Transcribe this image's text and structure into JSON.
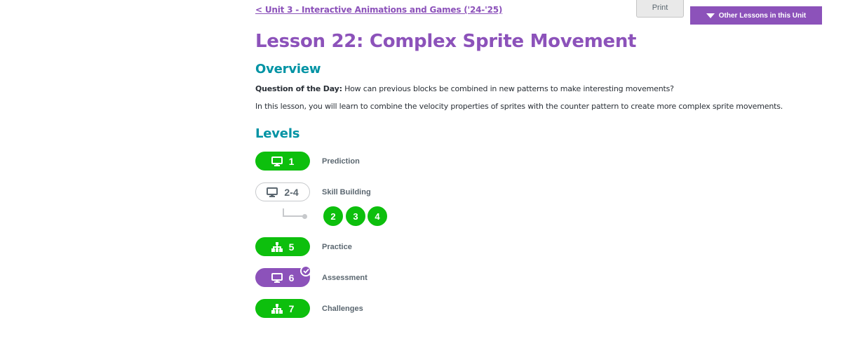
{
  "header": {
    "back_link": "< Unit 3 - Interactive Animations and Games ('24-'25)",
    "print_label": "Print",
    "other_lessons_label": "Other Lessons in this Unit"
  },
  "lesson": {
    "title": "Lesson 22: Complex Sprite Movement"
  },
  "overview": {
    "heading": "Overview",
    "qotd_label": "Question of the Day:",
    "qotd_text": " How can previous blocks be combined in new patterns to make interesting movements?",
    "intro": "In this lesson, you will learn to combine the velocity properties of sprites with the counter pattern to create more complex sprite movements."
  },
  "levels": {
    "heading": "Levels",
    "items": [
      {
        "number": "1",
        "label": "Prediction",
        "icon": "desktop-icon",
        "style": "green"
      },
      {
        "number": "2-4",
        "label": "Skill Building",
        "icon": "desktop-icon",
        "style": "outline",
        "sublevels": [
          "2",
          "3",
          "4"
        ]
      },
      {
        "number": "5",
        "label": "Practice",
        "icon": "sitemap-icon",
        "style": "green"
      },
      {
        "number": "6",
        "label": "Assessment",
        "icon": "desktop-icon",
        "style": "purple",
        "completed": true
      },
      {
        "number": "7",
        "label": "Challenges",
        "icon": "sitemap-icon",
        "style": "green"
      }
    ]
  },
  "colors": {
    "accent_purple": "#8c52ba",
    "heading_teal": "#0093a4",
    "level_green": "#0dbf0d",
    "outline_gray": "#c7c9cc"
  }
}
